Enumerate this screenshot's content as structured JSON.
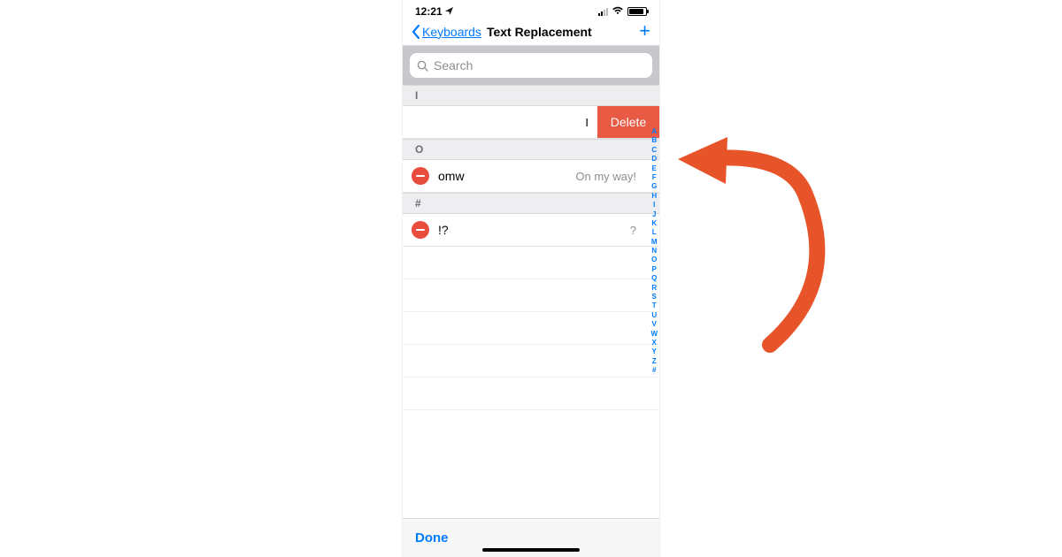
{
  "status": {
    "time": "12:21"
  },
  "nav": {
    "back_label": "Keyboards",
    "title": "Text Replacement"
  },
  "search": {
    "placeholder": "Search"
  },
  "sections": {
    "i": {
      "header": "I",
      "swiped_shortcut": "I",
      "delete_label": "Delete"
    },
    "o": {
      "header": "O",
      "items": [
        {
          "shortcut": "omw",
          "phrase": "On my way!"
        }
      ]
    },
    "hash": {
      "header": "#",
      "items": [
        {
          "shortcut": "!?",
          "phrase": "?"
        }
      ]
    }
  },
  "index_letters": [
    "A",
    "B",
    "C",
    "D",
    "E",
    "F",
    "G",
    "H",
    "I",
    "J",
    "K",
    "L",
    "M",
    "N",
    "O",
    "P",
    "Q",
    "R",
    "S",
    "T",
    "U",
    "V",
    "W",
    "X",
    "Y",
    "Z",
    "#"
  ],
  "bottom": {
    "done_label": "Done"
  },
  "colors": {
    "accent": "#007aff",
    "delete": "#e85a43",
    "arrow": "#e8542a"
  }
}
